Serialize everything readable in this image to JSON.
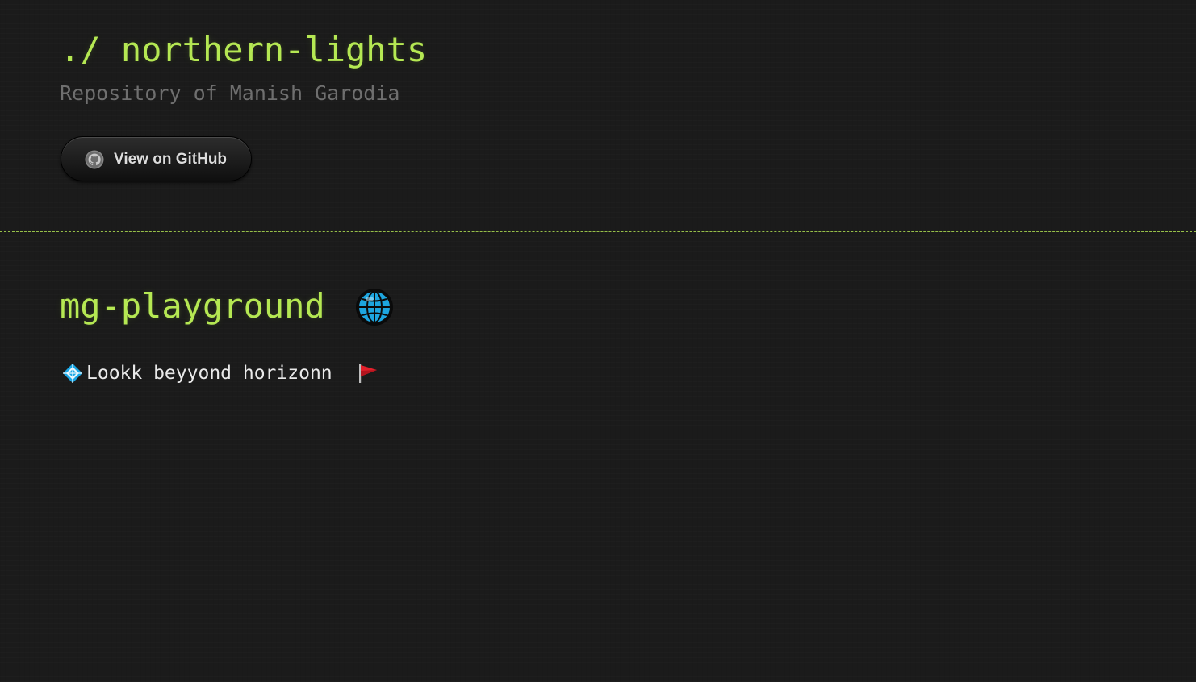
{
  "header": {
    "title": "./ northern-lights",
    "subtitle": "Repository of Manish Garodia",
    "github_button": {
      "label": "View on GitHub",
      "icon": "github-octocat-icon"
    }
  },
  "main": {
    "heading": "mg-playground",
    "heading_icon": "globe-icon",
    "description": "Lookk beyyond horizonn",
    "description_leading_icon": "blue-diamond-icon",
    "description_trailing_icon": "red-flag-icon"
  },
  "colors": {
    "background": "#1b1b1b",
    "accent": "#b5e853",
    "subtitle": "#6f6f6f",
    "body_text": "#eaeaea",
    "button_text": "#dcdcdc"
  }
}
